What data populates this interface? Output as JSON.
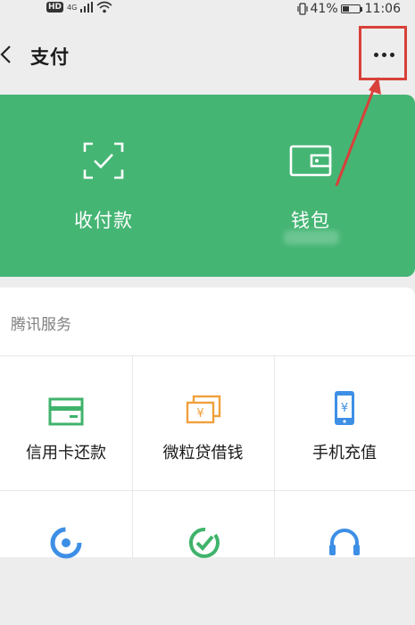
{
  "status_bar": {
    "hd": "HD",
    "network": "4G",
    "battery": "41%",
    "battery_level": 0.41,
    "time": "11:06"
  },
  "header": {
    "title": "支付"
  },
  "wallet_card": {
    "items": [
      {
        "label": "收付款",
        "icon": "scan-qr-icon"
      },
      {
        "label": "钱包",
        "icon": "wallet-icon"
      }
    ]
  },
  "services": {
    "section_title": "腾讯服务",
    "items": [
      {
        "label": "信用卡还款",
        "icon": "credit-card-icon",
        "color": "#3fb36b"
      },
      {
        "label": "微粒贷借钱",
        "icon": "money-notes-icon",
        "color": "#f0a03c"
      },
      {
        "label": "手机充值",
        "icon": "phone-yuan-icon",
        "color": "#3d8fe6"
      },
      {
        "label": "",
        "icon": "refresh-icon",
        "color": "#3d8fe6"
      },
      {
        "label": "",
        "icon": "check-leaf-icon",
        "color": "#3fb36b"
      },
      {
        "label": "",
        "icon": "headset-icon",
        "color": "#3d8fe6"
      }
    ]
  },
  "colors": {
    "accent_green": "#45b574",
    "highlight_red": "#d9403a"
  }
}
